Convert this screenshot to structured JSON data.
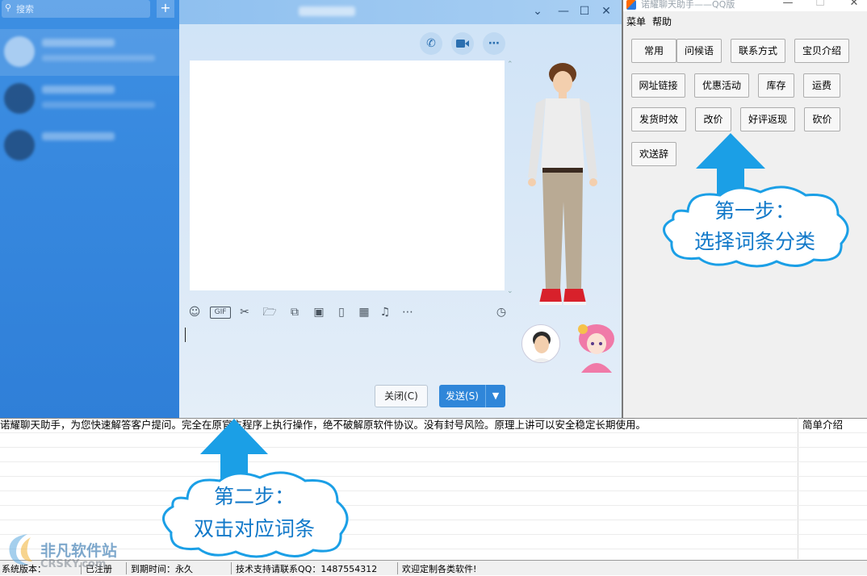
{
  "qq": {
    "search_placeholder": "搜索",
    "plus": "+",
    "close_button": "关闭(C)",
    "send_button": "发送(S)"
  },
  "assistant": {
    "title": "诺耀聊天助手——QQ版",
    "menu": [
      "菜单",
      "帮助"
    ],
    "categories": [
      "常用",
      "问候语",
      "联系方式",
      "宝贝介绍",
      "网址链接",
      "优惠活动",
      "库存",
      "运费",
      "发货时效",
      "改价",
      "好评返现",
      "砍价",
      "欢送辞"
    ]
  },
  "list": {
    "row1_desc": "诺耀聊天助手，为您快速解答客户提问。完全在原官方程序上执行操作，绝不破解原软件协议。没有封号风险。原理上讲可以安全稳定长期使用。",
    "row1_col2": "简单介绍"
  },
  "status": {
    "version": "系统版本：",
    "registered": "已注册",
    "expiry": "到期时间：永久",
    "support": "技术支持请联系QQ：1487554312",
    "welcome": "欢迎定制各类软件!"
  },
  "annotations": {
    "step1_line1": "第一步：",
    "step1_line2": "选择词条分类",
    "step2_line1": "第二步：",
    "step2_line2": "双击对应词条"
  },
  "watermark": {
    "cn": "非凡软件站",
    "en": "CRSKY.com"
  },
  "colors": {
    "qq_sidebar": "#2f7fd8",
    "annotation_blue": "#1279c9",
    "arrow_blue": "#1b9fe6",
    "send_button": "#2f86d9"
  }
}
